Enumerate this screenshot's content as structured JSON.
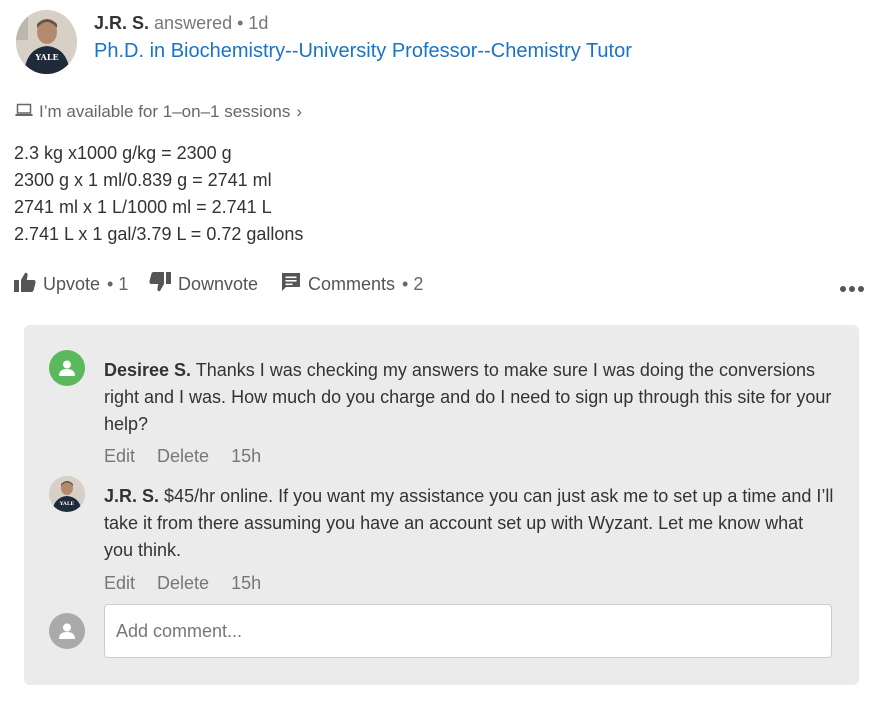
{
  "author": {
    "name": "J.R. S.",
    "meta": "answered • 1d",
    "headline": "Ph.D. in Biochemistry--University Professor--Chemistry Tutor",
    "shirt_text": "YALE"
  },
  "availability": {
    "text": "I’m available for 1–on–1 sessions",
    "chevron": "›",
    "icon": "laptop-icon"
  },
  "answer": {
    "lines": [
      "2.3 kg x1000 g/kg = 2300 g",
      "2300 g x 1 ml/0.839 g = 2741 ml",
      "2741 ml x 1 L/1000 ml = 2.741 L",
      "2.741 L x 1 gal/3.79 L = 0.72 gallons"
    ]
  },
  "actions": {
    "upvote_label": "Upvote",
    "upvote_count": "• 1",
    "downvote_label": "Downvote",
    "comments_label": "Comments",
    "comments_count": "• 2"
  },
  "comments": [
    {
      "author": "Desiree S.",
      "text": "Thanks I was checking my answers to make sure I was doing the conversions right and I was. How much do you charge and do I need to sign up through this site for your help?",
      "edit": "Edit",
      "delete": "Delete",
      "time": "15h"
    },
    {
      "author": "J.R. S.",
      "text": "$45/hr online. If you want my assistance you can just ask me to set up a time and I’ll take it from there assuming you have an account set up with Wyzant. Let me know what you think.",
      "edit": "Edit",
      "delete": "Delete",
      "time": "15h"
    }
  ],
  "add_comment": {
    "placeholder": "Add comment..."
  },
  "colors": {
    "link": "#1a73c7",
    "panel_bg": "#ebebeb",
    "avatar_green": "#5cb85c",
    "avatar_grey": "#aaaaaa"
  }
}
